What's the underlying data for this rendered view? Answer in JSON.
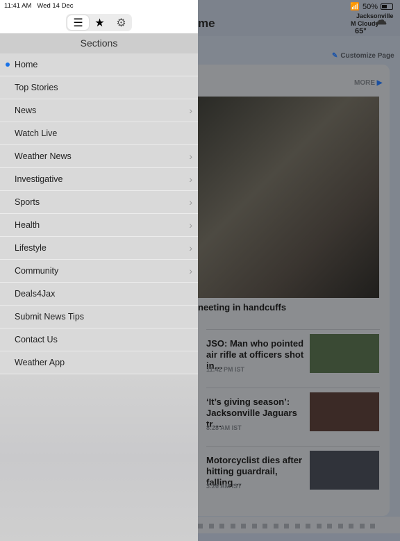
{
  "status": {
    "time": "11:41 AM",
    "date": "Wed 14 Dec",
    "battery": "50%"
  },
  "page": {
    "title_partial": "me",
    "customize": "Customize Page",
    "more": "MORE",
    "weather": {
      "city": "Jacksonville",
      "condition": "M Cloudy",
      "temp": "65°"
    },
    "hero_headline_partial": "neeting in handcuffs",
    "stories": [
      {
        "title": "JSO: Man who pointed air rifle at officers shot in…",
        "time": "11:42 PM IST",
        "thumb_color": "#3a4a34"
      },
      {
        "title": "‘It’s giving season’: Jacksonville Jaguars tr…",
        "time": "8:28 AM IST",
        "thumb_color": "#3b2a26"
      },
      {
        "title": "Motorcyclist dies after hitting guardrail, falling…",
        "time": "3:26 AM IST",
        "thumb_color": "#30333a"
      }
    ]
  },
  "menu": {
    "tabs": [
      {
        "icon": "list-icon",
        "glyph": "☰"
      },
      {
        "icon": "star-icon",
        "glyph": "★"
      },
      {
        "icon": "gear-icon",
        "glyph": "⚙"
      }
    ],
    "header": "Sections",
    "items": [
      {
        "label": "Home",
        "selected": true,
        "chevron": false
      },
      {
        "label": "Top Stories",
        "chevron": false
      },
      {
        "label": "News",
        "chevron": true
      },
      {
        "label": "Watch Live",
        "chevron": false
      },
      {
        "label": "Weather News",
        "chevron": true
      },
      {
        "label": "Investigative",
        "chevron": true
      },
      {
        "label": "Sports",
        "chevron": true
      },
      {
        "label": "Health",
        "chevron": true
      },
      {
        "label": "Lifestyle",
        "chevron": true
      },
      {
        "label": "Community",
        "chevron": true
      },
      {
        "label": "Deals4Jax",
        "chevron": false
      },
      {
        "label": "Submit News Tips",
        "chevron": false
      },
      {
        "label": "Contact Us",
        "chevron": false
      },
      {
        "label": "Weather App",
        "chevron": false
      }
    ]
  },
  "colors": {
    "accent": "#1a73e8"
  }
}
